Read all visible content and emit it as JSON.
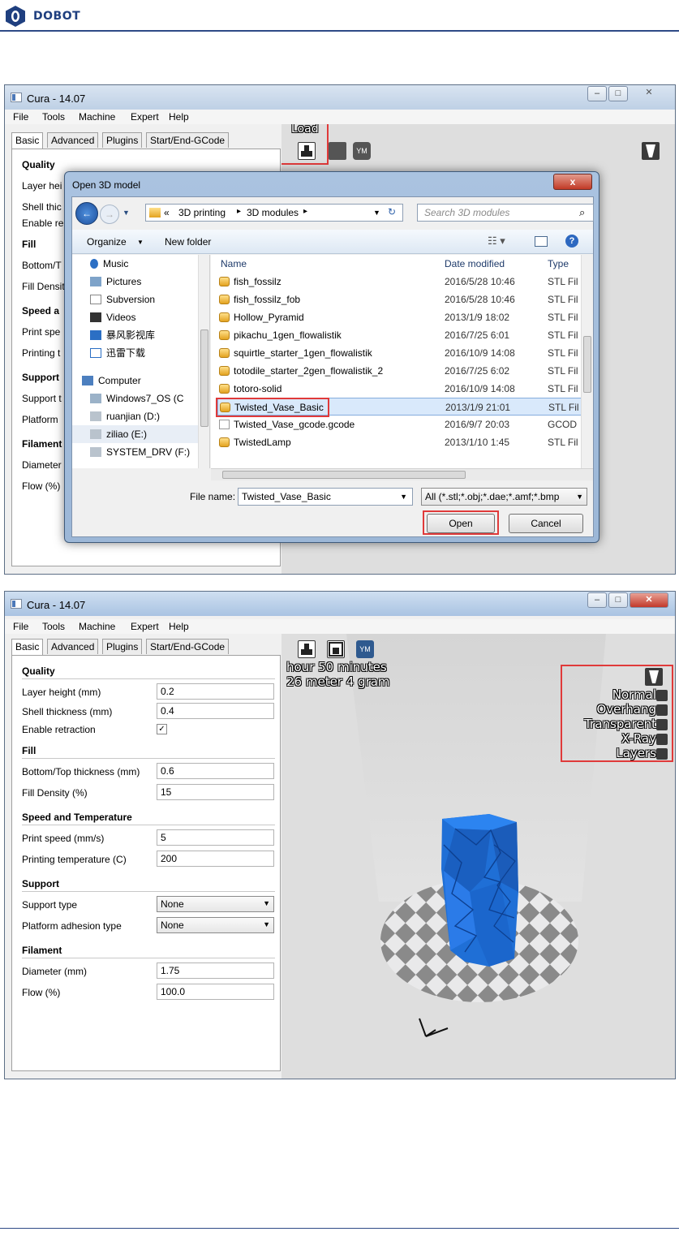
{
  "brand": {
    "logo_text": "DOBOT",
    "color": "#1f3f7f"
  },
  "window1": {
    "title": "Cura - 14.07",
    "menu": [
      "File",
      "Tools",
      "Machine",
      "Expert",
      "Help"
    ],
    "tabs": [
      "Basic",
      "Advanced",
      "Plugins",
      "Start/End-GCode"
    ],
    "load_label": "Load",
    "partial_labels": {
      "quality": "Quality",
      "layer": "Layer hei",
      "shell": "Shell thic",
      "enable": "Enable re",
      "fill": "Fill",
      "bottom": "Bottom/T",
      "fill_density": "Fill Densit",
      "speed": "Speed a",
      "print_speed": "Print spe",
      "printing": "Printing t",
      "support": "Support",
      "support_type": "Support t",
      "platform": "Platform",
      "filament": "Filament",
      "diameter": "Diameter",
      "flow": "Flow (%)"
    }
  },
  "dialog": {
    "title": "Open 3D model",
    "close": "x",
    "breadcrumb": [
      "«",
      "3D printing",
      "3D modules"
    ],
    "search_placeholder": "Search 3D modules",
    "organize": "Organize",
    "new_folder": "New folder",
    "nav_items": [
      {
        "label": "Music",
        "icon": "music-icon"
      },
      {
        "label": "Pictures",
        "icon": "pictures-icon"
      },
      {
        "label": "Subversion",
        "icon": "document-icon"
      },
      {
        "label": "Videos",
        "icon": "video-icon"
      },
      {
        "label": "暴风影视库",
        "icon": "library-icon"
      },
      {
        "label": "迅雷下载",
        "icon": "download-icon"
      },
      {
        "label": "Computer",
        "icon": "computer-icon"
      },
      {
        "label": "Windows7_OS (C",
        "icon": "drive-icon"
      },
      {
        "label": "ruanjian (D:)",
        "icon": "drive-icon"
      },
      {
        "label": "ziliao (E:)",
        "icon": "drive-icon"
      },
      {
        "label": "SYSTEM_DRV (F:)",
        "icon": "drive-icon"
      }
    ],
    "columns": [
      "Name",
      "Date modified",
      "Type"
    ],
    "files": [
      {
        "name": "fish_fossilz",
        "date": "2016/5/28 10:46",
        "type": "STL Fil"
      },
      {
        "name": "fish_fossilz_fob",
        "date": "2016/5/28 10:46",
        "type": "STL Fil"
      },
      {
        "name": "Hollow_Pyramid",
        "date": "2013/1/9 18:02",
        "type": "STL Fil"
      },
      {
        "name": "pikachu_1gen_flowalistik",
        "date": "2016/7/25 6:01",
        "type": "STL Fil"
      },
      {
        "name": "squirtle_starter_1gen_flowalistik",
        "date": "2016/10/9 14:08",
        "type": "STL Fil"
      },
      {
        "name": "totodile_starter_2gen_flowalistik_2",
        "date": "2016/7/25 6:02",
        "type": "STL Fil"
      },
      {
        "name": "totoro-solid",
        "date": "2016/10/9 14:08",
        "type": "STL Fil"
      },
      {
        "name": "Twisted_Vase_Basic",
        "date": "2013/1/9 21:01",
        "type": "STL Fil"
      },
      {
        "name": "Twisted_Vase_gcode.gcode",
        "date": "2016/9/7 20:03",
        "type": "GCOD"
      },
      {
        "name": "TwistedLamp",
        "date": "2013/1/10 1:45",
        "type": "STL Fil"
      }
    ],
    "selected_index": 7,
    "file_name_label": "File name:",
    "file_name_value": "Twisted_Vase_Basic",
    "file_type": "All (*.stl;*.obj;*.dae;*.amf;*.bmp",
    "open": "Open",
    "cancel": "Cancel"
  },
  "window2": {
    "title": "Cura - 14.07",
    "menu": [
      "File",
      "Tools",
      "Machine",
      "Expert",
      "Help"
    ],
    "tabs": [
      "Basic",
      "Advanced",
      "Plugins",
      "Start/End-GCode"
    ],
    "sections": {
      "quality": "Quality",
      "fill": "Fill",
      "speed": "Speed and Temperature",
      "support": "Support",
      "filament": "Filament"
    },
    "fields": {
      "layer_height": {
        "label": "Layer height (mm)",
        "value": "0.2"
      },
      "shell_thickness": {
        "label": "Shell thickness (mm)",
        "value": "0.4"
      },
      "enable_retraction": {
        "label": "Enable retraction",
        "value": "✓"
      },
      "bottom_top": {
        "label": "Bottom/Top thickness (mm)",
        "value": "0.6"
      },
      "fill_density": {
        "label": "Fill Density (%)",
        "value": "15"
      },
      "print_speed": {
        "label": "Print speed (mm/s)",
        "value": "5"
      },
      "printing_temp": {
        "label": "Printing temperature (C)",
        "value": "200"
      },
      "support_type": {
        "label": "Support type",
        "value": "None"
      },
      "platform_adhesion": {
        "label": "Platform adhesion type",
        "value": "None"
      },
      "diameter": {
        "label": "Diameter (mm)",
        "value": "1.75"
      },
      "flow": {
        "label": "Flow (%)",
        "value": "100.0"
      }
    },
    "estimate": [
      "hour 50 minutes",
      "26 meter 4 gram"
    ],
    "toolbar_ym": "YM",
    "view_modes": [
      "Normal",
      "Overhang",
      "Transparent",
      "X-Ray",
      "Layers"
    ],
    "model_color": "#1f6fd6"
  },
  "colors": {
    "highlight": "#e03a3a",
    "viewport": "#dedede"
  }
}
